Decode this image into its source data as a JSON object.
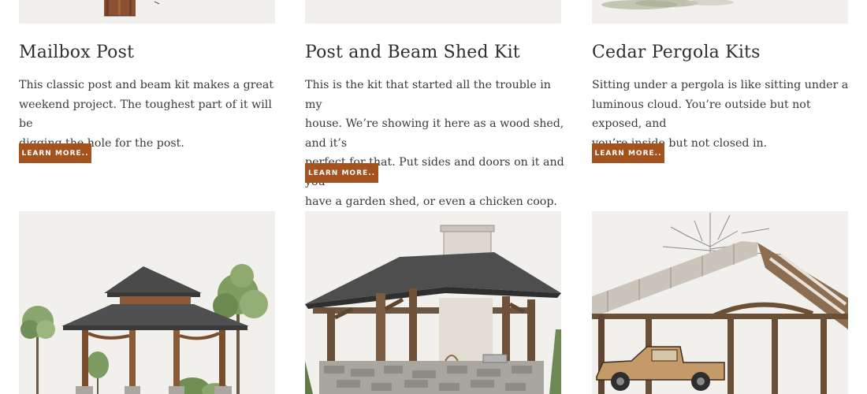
{
  "products": [
    {
      "title": "Mailbox Post",
      "description_lines": [
        "This classic post and beam kit makes a great",
        "weekend project. The toughest part of it will be",
        "digging the hole for the post."
      ],
      "button_label": "LEARN MORE..",
      "image_icon": "mailbox-post-illustration"
    },
    {
      "title": "Post and Beam Shed Kit",
      "description_lines": [
        "This is the kit that started all the trouble in my",
        "house. We’re showing it here as a wood shed, and it’s",
        "perfect for that. Put sides and doors on it and you",
        "have a garden shed, or even a chicken coop."
      ],
      "button_label": "LEARN MORE..",
      "image_icon": "shed-illustration"
    },
    {
      "title": "Cedar Pergola Kits",
      "description_lines": [
        "Sitting under a pergola is like sitting under a",
        "luminous cloud. You’re outside but not exposed, and",
        "you’re inside but not closed in."
      ],
      "button_label": "LEARN MORE..",
      "image_icon": "pergola-illustration"
    }
  ],
  "gallery": [
    {
      "image_icon": "gazebo-illustration"
    },
    {
      "image_icon": "outdoor-kitchen-pavilion-illustration"
    },
    {
      "image_icon": "timber-carport-illustration"
    }
  ],
  "colors": {
    "button_bg": "#a4531f",
    "image_bg": "#f1f0ec",
    "text": "#2e2e2e"
  }
}
